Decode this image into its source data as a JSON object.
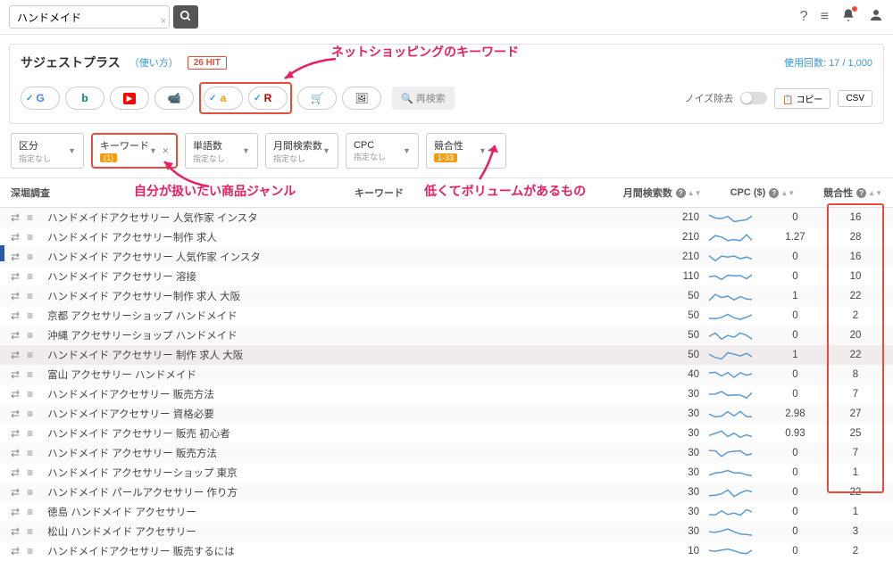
{
  "search": {
    "value": "ハンドメイド",
    "placeholder": ""
  },
  "header_icons": [
    "help",
    "menu",
    "bell",
    "user"
  ],
  "panel": {
    "title": "サジェストプラス",
    "usage_link": "（使い方）",
    "hit_badge": "26 HIT",
    "usage_count": "使用回数: 17 / 1,000"
  },
  "sources": [
    {
      "id": "google",
      "label": "G",
      "checked": true,
      "color": "#4285f4"
    },
    {
      "id": "bing",
      "label": "b",
      "checked": false,
      "color": "#008373"
    },
    {
      "id": "youtube",
      "label": "▶",
      "checked": false,
      "color": "#ff0000"
    },
    {
      "id": "video",
      "label": "■",
      "checked": false,
      "color": "#333"
    },
    {
      "id": "amazon",
      "label": "a",
      "checked": true,
      "color": "#ff9900"
    },
    {
      "id": "rakuten",
      "label": "R",
      "checked": true,
      "color": "#bf0000"
    },
    {
      "id": "cart",
      "label": "🛒",
      "checked": false,
      "color": "#333"
    },
    {
      "id": "image",
      "label": "🖼",
      "checked": false,
      "color": "#333"
    }
  ],
  "research_btn": "再検索",
  "noise_label": "ノイズ除去",
  "copy_btn": "コピー",
  "csv_btn": "CSV",
  "annotations": {
    "top": "ネットショッピングのキーワード",
    "left": "自分が扱いたい商品ジャンル",
    "right": "低くてボリュームがあるもの"
  },
  "filters": [
    {
      "label": "区分",
      "sub": "指定なし",
      "badge": null,
      "closable": false
    },
    {
      "label": "キーワード",
      "sub": null,
      "badge": "(1)",
      "closable": true,
      "highlight": true
    },
    {
      "label": "単語数",
      "sub": "指定なし",
      "badge": null,
      "closable": false
    },
    {
      "label": "月間検索数",
      "sub": "指定なし",
      "badge": null,
      "closable": false
    },
    {
      "label": "CPC",
      "sub": "指定なし",
      "badge": null,
      "closable": false
    },
    {
      "label": "競合性",
      "sub": null,
      "badge": "1-33",
      "closable": true
    }
  ],
  "columns": {
    "deep": "深堀調査",
    "keyword": "キーワード",
    "volume": "月間検索数",
    "cpc": "CPC ($)",
    "comp": "競合性"
  },
  "rows": [
    {
      "kw": "ハンドメイドアクセサリー 人気作家 インスタ",
      "vol": 210,
      "cpc": "0",
      "comp": 16
    },
    {
      "kw": "ハンドメイド アクセサリー制作 求人",
      "vol": 210,
      "cpc": "1.27",
      "comp": 28
    },
    {
      "kw": "ハンドメイド アクセサリー 人気作家 インスタ",
      "vol": 210,
      "cpc": "0",
      "comp": 16
    },
    {
      "kw": "ハンドメイド アクセサリー 溶接",
      "vol": 110,
      "cpc": "0",
      "comp": 10
    },
    {
      "kw": "ハンドメイド アクセサリー制作 求人 大阪",
      "vol": 50,
      "cpc": "1",
      "comp": 22
    },
    {
      "kw": "京都 アクセサリーショップ ハンドメイド",
      "vol": 50,
      "cpc": "0",
      "comp": 2
    },
    {
      "kw": "沖縄 アクセサリーショップ ハンドメイド",
      "vol": 50,
      "cpc": "0",
      "comp": 20
    },
    {
      "kw": "ハンドメイド アクセサリー 制作 求人 大阪",
      "vol": 50,
      "cpc": "1",
      "comp": 22,
      "hl": true
    },
    {
      "kw": "富山 アクセサリー ハンドメイド",
      "vol": 40,
      "cpc": "0",
      "comp": 8
    },
    {
      "kw": "ハンドメイドアクセサリー 販売方法",
      "vol": 30,
      "cpc": "0",
      "comp": 7
    },
    {
      "kw": "ハンドメイドアクセサリー 資格必要",
      "vol": 30,
      "cpc": "2.98",
      "comp": 27
    },
    {
      "kw": "ハンドメイド アクセサリー 販売 初心者",
      "vol": 30,
      "cpc": "0.93",
      "comp": 25
    },
    {
      "kw": "ハンドメイド アクセサリー 販売方法",
      "vol": 30,
      "cpc": "0",
      "comp": 7
    },
    {
      "kw": "ハンドメイド アクセサリーショップ 東京",
      "vol": 30,
      "cpc": "0",
      "comp": 1
    },
    {
      "kw": "ハンドメイド パールアクセサリー 作り方",
      "vol": 30,
      "cpc": "0",
      "comp": 22
    },
    {
      "kw": "徳島 ハンドメイド アクセサリー",
      "vol": 30,
      "cpc": "0",
      "comp": 1
    },
    {
      "kw": "松山 ハンドメイド アクセサリー",
      "vol": 30,
      "cpc": "0",
      "comp": 3
    },
    {
      "kw": "ハンドメイドアクセサリー 販売するには",
      "vol": 10,
      "cpc": "0",
      "comp": 2
    }
  ]
}
